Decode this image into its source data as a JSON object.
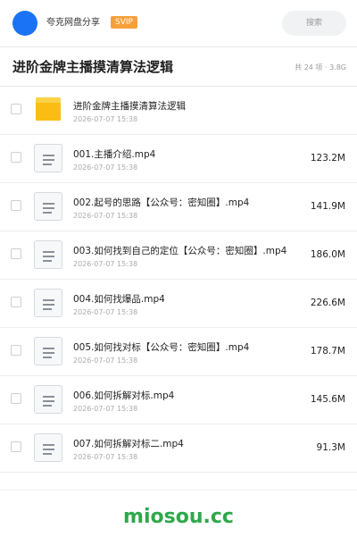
{
  "header": {
    "site_name": "夸克网盘分享",
    "badge": "SVIP",
    "search_label": "搜索",
    "avatar_color": "#1a73f5",
    "badge_color": "#f7a03a"
  },
  "title_bar": {
    "title": "进阶金牌主播摸清算法逻辑",
    "stats": "共 24 项 · 3.8G"
  },
  "files": [
    {
      "name": "进阶金牌主播摸清算法逻辑",
      "date": "2026-07-07 15:38",
      "size": "",
      "icon": "folder-icon"
    },
    {
      "name": "001.主播介绍.mp4",
      "date": "2026-07-07 15:38",
      "size": "123.2M",
      "icon": "file-icon"
    },
    {
      "name": "002.起号的思路【公众号：密知圈】.mp4",
      "date": "2026-07-07 15:38",
      "size": "141.9M",
      "icon": "file-icon"
    },
    {
      "name": "003.如何找到自己的定位【公众号：密知圈】.mp4",
      "date": "2026-07-07 15:38",
      "size": "186.0M",
      "icon": "file-icon"
    },
    {
      "name": "004.如何找爆品.mp4",
      "date": "2026-07-07 15:38",
      "size": "226.6M",
      "icon": "file-icon"
    },
    {
      "name": "005.如何找对标【公众号：密知圈】.mp4",
      "date": "2026-07-07 15:38",
      "size": "178.7M",
      "icon": "file-icon"
    },
    {
      "name": "006.如何拆解对标.mp4",
      "date": "2026-07-07 15:38",
      "size": "145.6M",
      "icon": "file-icon"
    },
    {
      "name": "007.如何拆解对标二.mp4",
      "date": "2026-07-07 15:38",
      "size": "91.3M",
      "icon": "file-icon"
    }
  ],
  "watermark": "miosou.cc",
  "watermark_color": "#2ea84a"
}
